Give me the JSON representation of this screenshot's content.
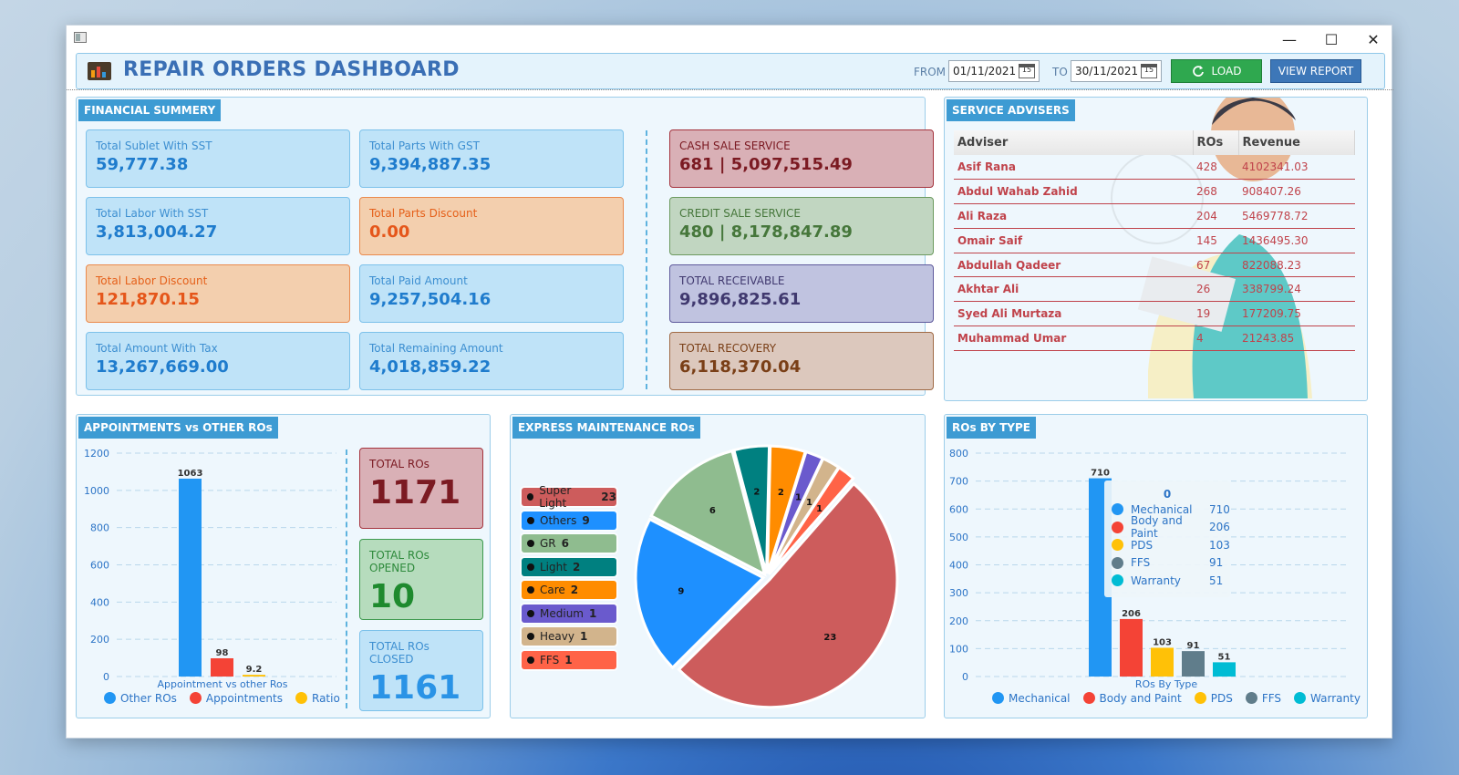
{
  "window": {
    "title": ""
  },
  "header": {
    "title": "REPAIR ORDERS DASHBOARD",
    "from_label": "FROM",
    "from_value": "01/11/2021",
    "to_label": "TO",
    "to_value": "30/11/2021",
    "calendar_glyph": "15",
    "load_label": "LOAD",
    "report_label": "VIEW REPORT"
  },
  "financial": {
    "tag": "FINANCIAL SUMMERY",
    "sublet": {
      "label": "Total Sublet With SST",
      "value": "59,777.38"
    },
    "parts_gst": {
      "label": "Total Parts With GST",
      "value": "9,394,887.35"
    },
    "labor_sst": {
      "label": "Total Labor With SST",
      "value": "3,813,004.27"
    },
    "parts_discount": {
      "label": "Total Parts Discount",
      "value": "0.00"
    },
    "labor_discount": {
      "label": "Total Labor Discount",
      "value": "121,870.15"
    },
    "paid_amount": {
      "label": "Total Paid Amount",
      "value": "9,257,504.16"
    },
    "amount_tax": {
      "label": "Total Amount With Tax",
      "value": "13,267,669.00"
    },
    "remaining": {
      "label": "Total Remaining Amount",
      "value": "4,018,859.22"
    },
    "cash_sale": {
      "label": "CASH SALE SERVICE",
      "value": "681 | 5,097,515.49"
    },
    "credit_sale": {
      "label": "CREDIT SALE SERVICE",
      "value": "480 | 8,178,847.89"
    },
    "receivable": {
      "label": "TOTAL RECEIVABLE",
      "value": "9,896,825.61"
    },
    "recovery": {
      "label": "TOTAL RECOVERY",
      "value": "6,118,370.04"
    }
  },
  "advisers": {
    "tag": "SERVICE ADVISERS",
    "columns": [
      "Adviser",
      "ROs",
      "Revenue"
    ],
    "rows": [
      [
        "Asif Rana",
        "428",
        "4102341.03"
      ],
      [
        "Abdul Wahab Zahid",
        "268",
        "908407.26"
      ],
      [
        "Ali Raza",
        "204",
        "5469778.72"
      ],
      [
        "Omair Saif",
        "145",
        "1436495.30"
      ],
      [
        "Abdullah Qadeer",
        "67",
        "822088.23"
      ],
      [
        "Akhtar Ali",
        "26",
        "338799.24"
      ],
      [
        "Syed Ali Murtaza",
        "19",
        "177209.75"
      ],
      [
        "Muhammad Umar",
        "4",
        "21243.85"
      ]
    ]
  },
  "appointments": {
    "tag": "APPOINTMENTS vs OTHER ROs",
    "total_ros": {
      "label": "TOTAL ROs",
      "value": "1171"
    },
    "opened": {
      "label": "TOTAL ROs OPENED",
      "value": "10"
    },
    "closed": {
      "label": "TOTAL ROs CLOSED",
      "value": "1161"
    }
  },
  "express": {
    "tag": "EXPRESS MAINTENANCE ROs"
  },
  "ros_type": {
    "tag": "ROs BY TYPE",
    "tooltip_header": "0"
  },
  "chart_data": [
    {
      "type": "bar",
      "xlabel": "Appointment vs other Ros",
      "ylim": [
        0,
        1200
      ],
      "yticks": [
        0,
        200,
        400,
        600,
        800,
        1000,
        1200
      ],
      "grid": true,
      "legend_position": "bottom",
      "series": [
        {
          "name": "Other ROs",
          "value": 1063,
          "label": "1063",
          "color": "#2196f3"
        },
        {
          "name": "Appointments",
          "value": 98,
          "label": "98",
          "color": "#f44336"
        },
        {
          "name": "Ratio",
          "value": 9.2,
          "label": "9.2",
          "color": "#ffc107"
        }
      ]
    },
    {
      "type": "pie",
      "legend_position": "left",
      "slices": [
        {
          "name": "Super Light",
          "value": 23,
          "color": "#cd5c5c"
        },
        {
          "name": "Others",
          "value": 9,
          "color": "#1e90ff"
        },
        {
          "name": "GR",
          "value": 6,
          "color": "#8fbc8f"
        },
        {
          "name": "Light",
          "value": 2,
          "color": "#008080"
        },
        {
          "name": "Care",
          "value": 2,
          "color": "#ff8c00"
        },
        {
          "name": "Medium",
          "value": 1,
          "color": "#6a5acd"
        },
        {
          "name": "Heavy",
          "value": 1,
          "color": "#d2b48c"
        },
        {
          "name": "FFS",
          "value": 1,
          "color": "#ff6347"
        }
      ]
    },
    {
      "type": "bar",
      "xlabel": "ROs By Type",
      "ylim": [
        0,
        800
      ],
      "yticks": [
        0,
        100,
        200,
        300,
        400,
        500,
        600,
        700,
        800
      ],
      "grid": true,
      "legend_position": "bottom",
      "series": [
        {
          "name": "Mechanical",
          "value": 710,
          "label": "710",
          "color": "#2196f3"
        },
        {
          "name": "Body and Paint",
          "value": 206,
          "label": "206",
          "color": "#f44336"
        },
        {
          "name": "PDS",
          "value": 103,
          "label": "103",
          "color": "#ffc107"
        },
        {
          "name": "FFS",
          "value": 91,
          "label": "91",
          "color": "#607d8b"
        },
        {
          "name": "Warranty",
          "value": 51,
          "label": "51",
          "color": "#00bcd4"
        }
      ]
    }
  ]
}
